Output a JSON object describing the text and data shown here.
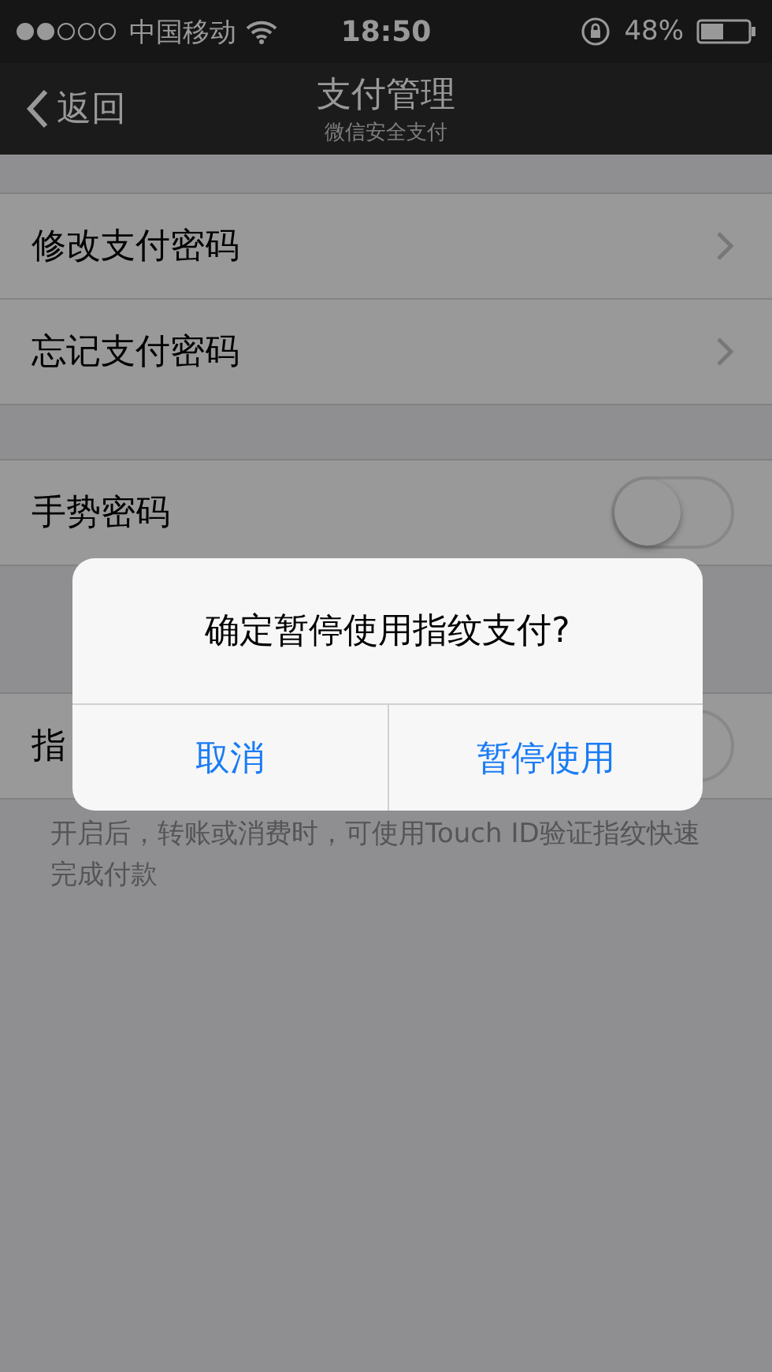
{
  "status_bar": {
    "carrier": "中国移动",
    "time": "18:50",
    "battery": "48%"
  },
  "nav": {
    "back": "返回",
    "title": "支付管理",
    "subtitle": "微信安全支付"
  },
  "sections": [
    {
      "rows": [
        {
          "kind": "link",
          "label": "修改支付密码"
        },
        {
          "kind": "link",
          "label": "忘记支付密码"
        }
      ]
    },
    {
      "rows": [
        {
          "kind": "toggle",
          "label": "手势密码",
          "on": false
        }
      ]
    },
    {
      "rows": [
        {
          "kind": "toggle",
          "label": "指",
          "on": false
        }
      ],
      "note": "开启后，转账或消费时，可使用Touch ID验证指纹快速完成付款"
    }
  ],
  "dialog": {
    "message": "确定暂停使用指纹支付?",
    "buttons": [
      "取消",
      "暂停使用"
    ]
  }
}
